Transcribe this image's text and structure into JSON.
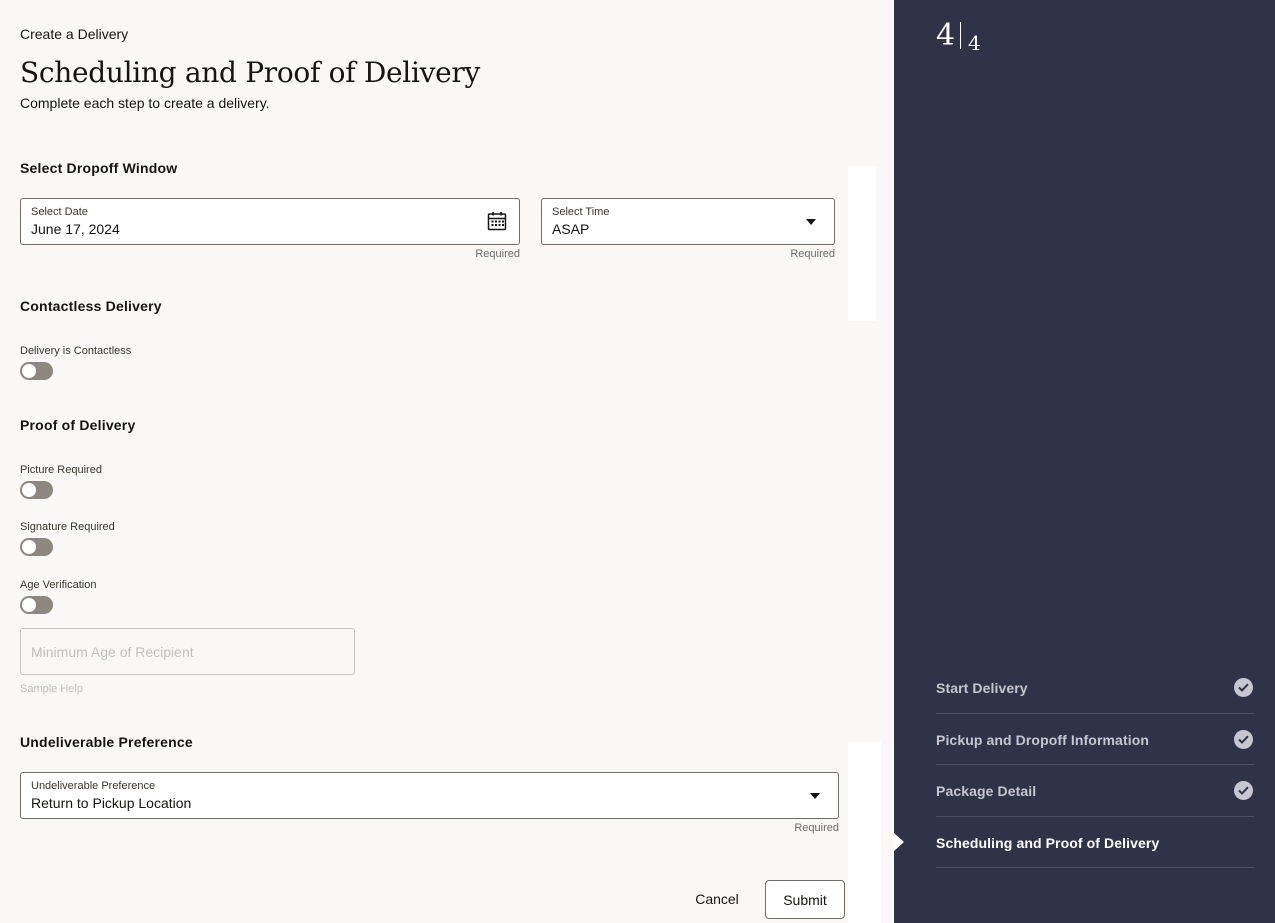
{
  "header": {
    "breadcrumb": "Create a Delivery",
    "title": "Scheduling and Proof of Delivery",
    "subtitle": "Complete each step to create a delivery."
  },
  "dropoff_window": {
    "heading": "Select Dropoff Window",
    "date": {
      "label": "Select Date",
      "value": "June 17, 2024",
      "helper": "Required",
      "icon": "calendar-icon"
    },
    "time": {
      "label": "Select Time",
      "value": "ASAP",
      "helper": "Required",
      "icon": "chevron-down-icon"
    }
  },
  "contactless": {
    "heading": "Contactless Delivery",
    "toggle_label": "Delivery is Contactless",
    "toggle_on": false
  },
  "proof": {
    "heading": "Proof of Delivery",
    "picture_label": "Picture Required",
    "picture_on": false,
    "signature_label": "Signature Required",
    "signature_on": false,
    "age_label": "Age Verification",
    "age_on": false,
    "min_age_placeholder": "Minimum Age of Recipient",
    "min_age_help": "Sample Help"
  },
  "undeliverable": {
    "heading": "Undeliverable Preference",
    "label": "Undeliverable Preference",
    "value": "Return to Pickup Location",
    "helper": "Required"
  },
  "actions": {
    "cancel": "Cancel",
    "submit": "Submit"
  },
  "train": {
    "current": "4",
    "total": "4",
    "steps": [
      {
        "label": "Start Delivery",
        "complete": true
      },
      {
        "label": "Pickup and Dropoff Information",
        "complete": true
      },
      {
        "label": "Package Detail",
        "complete": true
      },
      {
        "label": "Scheduling and Proof of Delivery",
        "complete": false,
        "active": true
      }
    ]
  },
  "colors": {
    "sidebar": "#303348",
    "background": "#f9f8f6",
    "toggle_off": "#8d8780"
  }
}
